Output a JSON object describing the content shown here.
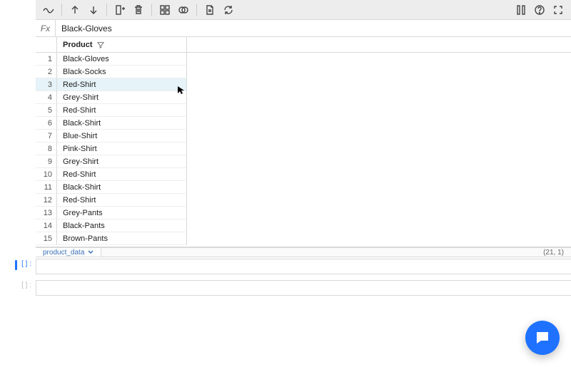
{
  "fx": {
    "label": "Fx",
    "value": "Black-Gloves"
  },
  "column_header": "Product",
  "rows": [
    "Black-Gloves",
    "Black-Socks",
    "Red-Shirt",
    "Grey-Shirt",
    "Red-Shirt",
    "Black-Shirt",
    "Blue-Shirt",
    "Pink-Shirt",
    "Grey-Shirt",
    "Red-Shirt",
    "Black-Shirt",
    "Red-Shirt",
    "Grey-Pants",
    "Black-Pants",
    "Brown-Pants"
  ],
  "highlight_row_index": 2,
  "sheet": {
    "name": "product_data",
    "dims": "(21, 1)"
  },
  "console": {
    "active_prompt": "[  ] :",
    "idle_prompt": "[  ] :"
  }
}
